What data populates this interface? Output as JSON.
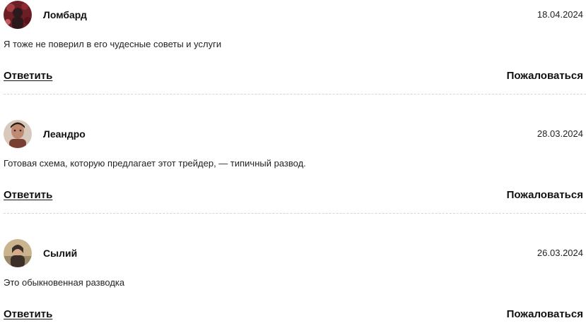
{
  "comments": [
    {
      "author": "Ломбард",
      "date": "18.04.2024",
      "text": "Я тоже не поверил в его чудесные советы и услуги",
      "reply_label": "Ответить",
      "report_label": "Пожаловаться",
      "avatar_colors": [
        "#6b1e24",
        "#2b1a1c"
      ]
    },
    {
      "author": "Леандро",
      "date": "28.03.2024",
      "text": "Готовая схема, которую предлагает этот трейдер, — типичный развод.",
      "reply_label": "Ответить",
      "report_label": "Пожаловаться",
      "avatar_colors": [
        "#7a3f33",
        "#2a1d1a"
      ]
    },
    {
      "author": "Сылий",
      "date": "26.03.2024",
      "text": "Это обыкновенная разводка",
      "reply_label": "Ответить",
      "report_label": "Пожаловаться",
      "avatar_colors": [
        "#c9b48d",
        "#3b2f28"
      ]
    }
  ]
}
